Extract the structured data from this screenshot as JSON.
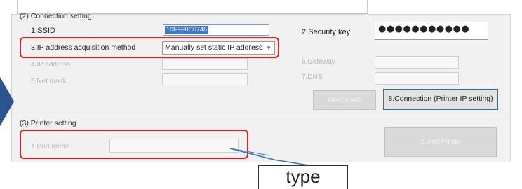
{
  "sections": {
    "connection_title": "(2) Connection setting",
    "printer_title": "(3) Printer setting"
  },
  "connection": {
    "ssid_label": "1.SSID",
    "ssid_value": "10FFF0C0746",
    "security_key_label": "2.Security key",
    "security_key_value": "●●●●●●●●●●●",
    "ip_method_label": "3.IP address acquisition method",
    "ip_method_value": "Manually set static IP address",
    "ip_address_label": "4.IP address",
    "subnet_label": "5.Net mask",
    "gateway_label": "6.Gateway",
    "dns_label": "7.DNS",
    "disconnect_label": "Disconnect",
    "connection_button_label": "8.Connection (Printer IP setting)"
  },
  "printer": {
    "port_name_label": "1.Port name",
    "add_printer_label": "2. Add Printer"
  },
  "annotation": {
    "callout_text": "type",
    "highlight_color": "#e02020",
    "callout_line_color": "#3a6fbf"
  },
  "colors": {
    "panel_bg": "#f1f1f1",
    "arrow_blue": "#2a5590"
  }
}
